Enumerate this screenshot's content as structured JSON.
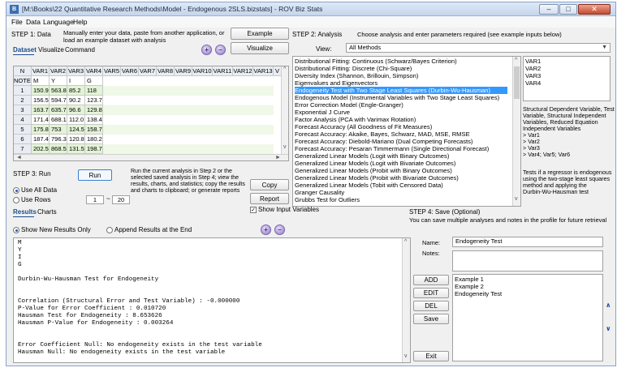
{
  "window": {
    "title": "[M:\\Books\\22 Quantitative Research Methods\\Model - Endogenous 2SLS.bizstats] - ROV Biz Stats",
    "app_icon_text": "B",
    "controls": {
      "minimize": "–",
      "maximize": "□",
      "close": "✕"
    }
  },
  "menu": [
    "File",
    "Data",
    "Language",
    "Help"
  ],
  "step1": {
    "label": "STEP 1: Data",
    "description": "Manually enter your data, paste from another application, or load an example dataset with analysis",
    "example_button": "Example",
    "visualize_button": "Visualize",
    "tabs": [
      "Dataset",
      "Visualize",
      "Command"
    ],
    "zoom_in_icon": "+",
    "zoom_out_icon": "–"
  },
  "grid": {
    "columns": [
      "N",
      "VAR1",
      "VAR2",
      "VAR3",
      "VAR4",
      "VAR5",
      "VAR6",
      "VAR7",
      "VAR8",
      "VAR9",
      "VAR10",
      "VAR11",
      "VAR12",
      "VAR13",
      "V"
    ],
    "notes_row": {
      "label": "NOTES",
      "values": [
        "M",
        "Y",
        "I",
        "G"
      ]
    },
    "rows": [
      {
        "n": "1",
        "values": [
          "150.9",
          "563.8",
          "85.2",
          "118"
        ]
      },
      {
        "n": "2",
        "values": [
          "156.5",
          "594.7",
          "90.2",
          "123.7"
        ]
      },
      {
        "n": "3",
        "values": [
          "163.7",
          "635.7",
          "96.6",
          "129.8"
        ]
      },
      {
        "n": "4",
        "values": [
          "171.4",
          "688.1",
          "112.0",
          "138.4"
        ]
      },
      {
        "n": "5",
        "values": [
          "175.8",
          "753",
          "124.5",
          "158.7"
        ]
      },
      {
        "n": "6",
        "values": [
          "187.4",
          "796.3",
          "120.8",
          "180.2"
        ]
      },
      {
        "n": "7",
        "values": [
          "202.5",
          "868.5",
          "131.5",
          "198.7"
        ]
      }
    ]
  },
  "step2": {
    "label": "STEP 2: Analysis",
    "description": "Choose analysis and enter parameters required (see example inputs below)",
    "view_label": "View:",
    "view_value": "All Methods",
    "methods": [
      "Distributional Fitting: Continuous (Schwarz/Bayes Criterion)",
      "Distributional Fitting: Discrete (Chi-Square)",
      "Diversity Index (Shannon, Brillouin, Simpson)",
      "Eigenvalues and Eigenvectors",
      "Endogeneity Test with Two Stage Least Squares (Durbin-Wu-Hausman)",
      "Endogenous Model (Instrumental Variables with Two Stage Least Squares)",
      "Error Correction Model (Engle-Granger)",
      "Exponential J Curve",
      "Factor Analysis (PCA with Varimax Rotation)",
      "Forecast Accuracy (All Goodness of Fit Measures)",
      "Forecast Accuracy: Akaike, Bayes, Schwarz, MAD, MSE, RMSE",
      "Forecast Accuracy: Diebold-Mariano (Dual Competing Forecasts)",
      "Forecast Accuracy: Pesaran Timmermann (Single Directional Forecast)",
      "Generalized Linear Models (Logit with Binary Outcomes)",
      "Generalized Linear Models (Logit with Bivariate Outcomes)",
      "Generalized Linear Models (Probit with Binary Outcomes)",
      "Generalized Linear Models (Probit with Bivariate Outcomes)",
      "Generalized Linear Models (Tobit with Censored Data)",
      "Granger Causality",
      "Grubbs Test for Outliers"
    ],
    "selected_index": 4,
    "variables": [
      "VAR1",
      "VAR2",
      "VAR3",
      "VAR4"
    ],
    "help_text": [
      "Structural Dependent Variable, Test",
      "Variable, Structural Independent",
      "Variables, Reduced Equation",
      "Independent Variables",
      ">  Var1",
      ">  Var2",
      ">  Var3",
      ">  Var4; Var5; Var6"
    ],
    "description_text": [
      "Tests if a regressor is endogenous",
      "using the two-stage least squares",
      "method and applying the",
      "Durbin-Wu-Hausman test"
    ]
  },
  "step3": {
    "label": "STEP 3: Run",
    "run_button": "Run",
    "description": "Run the current analysis in Step 2 or the selected saved analysis in Step 4; view the results, charts, and statistics; copy the results and charts to clipboard; or generate reports",
    "use_all_data": "Use All Data",
    "use_rows": "Use Rows",
    "row_from": "1",
    "row_to": "20",
    "row_separator": "~",
    "copy_button": "Copy",
    "report_button": "Report",
    "show_input_variables": "Show Input Variables",
    "show_input_checked": "✓"
  },
  "results": {
    "tabs": [
      "Results",
      "Charts"
    ],
    "show_new_only": "Show New Results Only",
    "append_at_end": "Append Results at the End",
    "lines": [
      "M",
      "Y",
      "I",
      "G",
      "",
      "Durbin-Wu-Hausman Test for Endogeneity",
      "",
      "",
      "Correlation (Structural Error and Test Variable) : -0.000000",
      "P-Value for Error Coefficient : 0.010720",
      "Hausman Test for Endogeneity : 8.653626",
      "Hausman P-Value for Endogeneity : 0.003264",
      "",
      "",
      "Error Coefficient Null: No endogeneity exists in the test variable",
      "Hausman Null: No endogeneity exists in the test variable"
    ]
  },
  "step4": {
    "label": "STEP 4: Save (Optional)",
    "description": "You can save multiple analyses and notes in the profile for future retrieval",
    "name_label": "Name:",
    "name_value": "Endogeneity Test",
    "notes_label": "Notes:",
    "add_button": "ADD",
    "edit_button": "EDIT",
    "del_button": "DEL",
    "save_button": "Save",
    "exit_button": "Exit",
    "saved_items": [
      "Example 1",
      "Example 2",
      "Endogeneity Test"
    ],
    "up_icon": "∧",
    "down_icon": "∨"
  },
  "scroll": {
    "up": "▲",
    "down": "▼",
    "left": "◄",
    "right": "►",
    "caret_up": "^",
    "caret_down": "v"
  }
}
